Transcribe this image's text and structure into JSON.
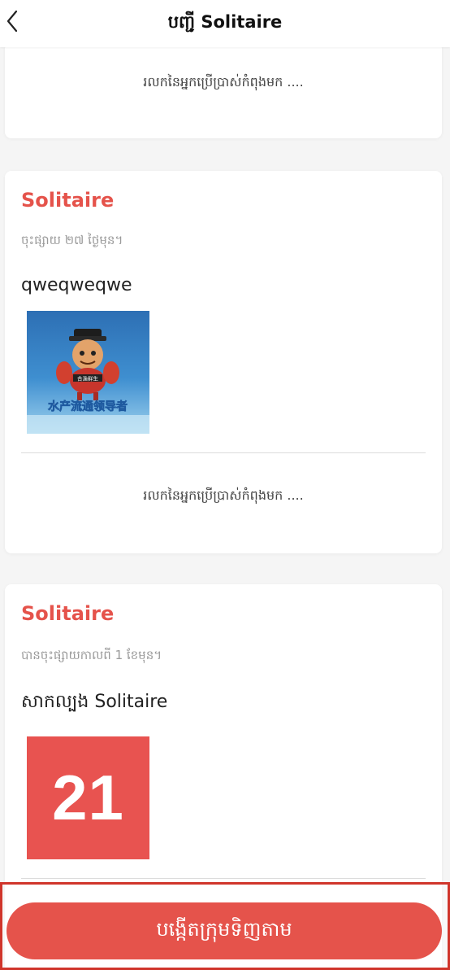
{
  "header": {
    "title": "បញ្ជី Solitaire"
  },
  "posts": [
    {
      "comments_loading": "រលកនៃអ្នកប្រើប្រាស់កំពុងមក ...."
    },
    {
      "title": "Solitaire",
      "time": "ចុះផ្សាយ ២៧ ថ្ងៃមុន។",
      "body": "qweqweqwe",
      "image_overlay_text": "水产流通领导者",
      "comments_loading": "រលកនៃអ្នកប្រើប្រាស់កំពុងមក ...."
    },
    {
      "title": "Solitaire",
      "time": "បានចុះផ្សាយកាលពី 1 ខែមុន។",
      "body": "សាកល្បង Solitaire",
      "image_text": "21"
    }
  ],
  "footer": {
    "create_button": "បង្កើតក្រុមទិញតាម"
  },
  "colors": {
    "accent": "#e5534b",
    "highlight_border": "#d0352b"
  }
}
